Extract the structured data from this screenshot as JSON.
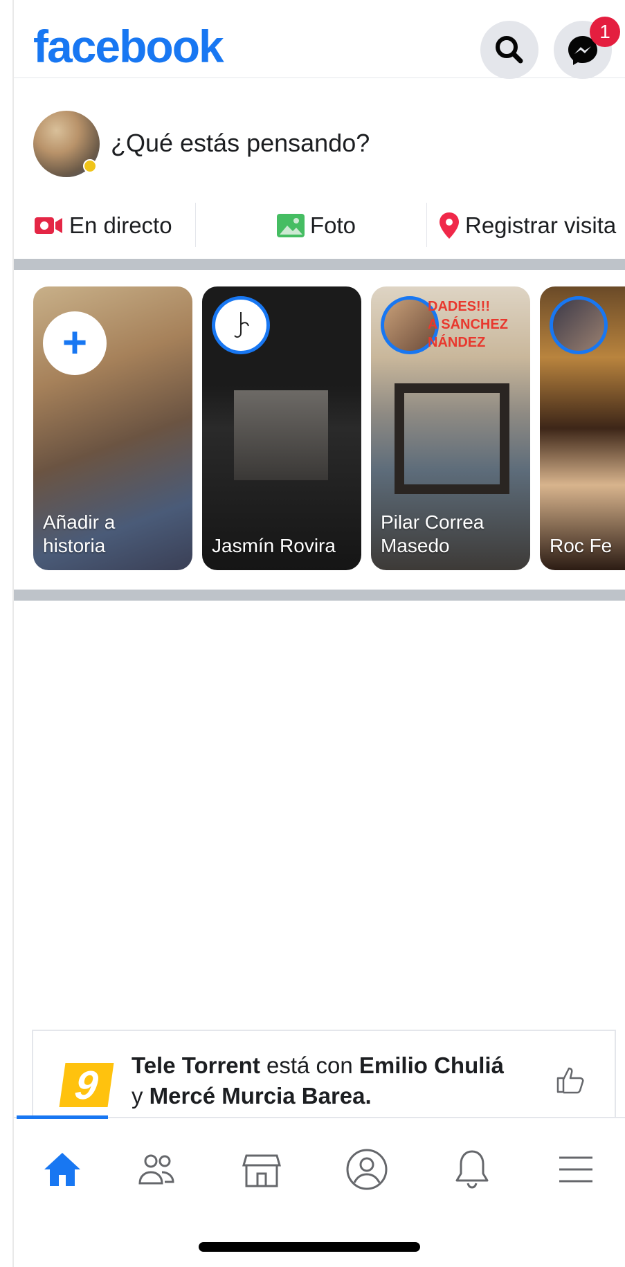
{
  "header": {
    "logo": "facebook",
    "search_icon": "search-icon",
    "messenger_icon": "messenger-icon",
    "messenger_badge": "1",
    "brand_color": "#1877f2"
  },
  "composer": {
    "placeholder": "¿Qué estás pensando?"
  },
  "actions": [
    {
      "label": "En directo",
      "icon": "live-video-icon",
      "color": "#e42645"
    },
    {
      "label": "Foto",
      "icon": "photo-icon",
      "color": "#45bd62"
    },
    {
      "label": "Registrar visita",
      "icon": "location-pin-icon",
      "color": "#f02849"
    }
  ],
  "stories": [
    {
      "name": "Añadir a\nhistoria",
      "type": "add"
    },
    {
      "name": "Jasmín Rovira",
      "type": "story"
    },
    {
      "name": "Pilar Correa\nMasedo",
      "type": "story",
      "overlay_text": "DADES!!!\nA SÁNCHEZ\nNÁNDEZ"
    },
    {
      "name": "Roc Fe",
      "type": "story"
    }
  ],
  "post": {
    "page": "Tele Torrent",
    "connector": "está con",
    "person1": "Emilio Chuliá",
    "and": "y",
    "person2": "Mercé Murcia Barea.",
    "logo_text": "9"
  },
  "tabbar": {
    "tabs": [
      {
        "icon": "home-icon",
        "active": true
      },
      {
        "icon": "friends-icon",
        "active": false
      },
      {
        "icon": "marketplace-icon",
        "active": false
      },
      {
        "icon": "profile-icon",
        "active": false
      },
      {
        "icon": "bell-icon",
        "active": false
      },
      {
        "icon": "menu-icon",
        "active": false
      }
    ]
  }
}
